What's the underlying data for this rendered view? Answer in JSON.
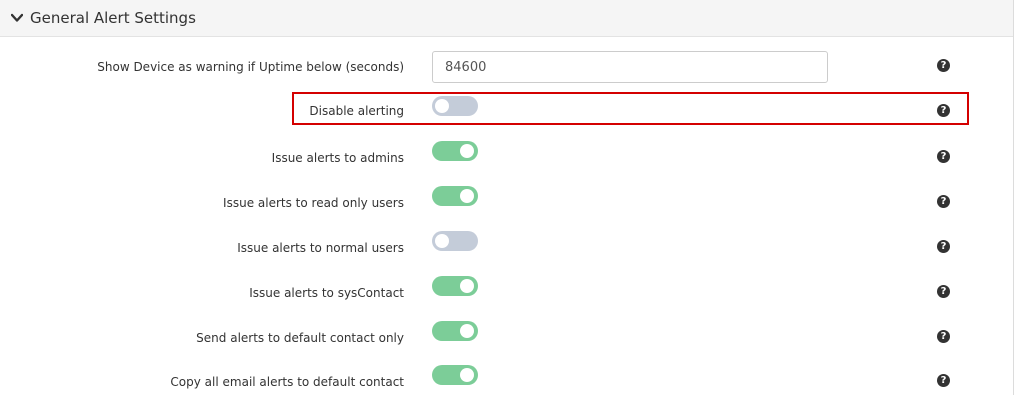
{
  "panel": {
    "title": "General Alert Settings",
    "collapse_icon": "chevron-down-icon"
  },
  "settings": [
    {
      "label": "Show Device as warning if Uptime below (seconds)",
      "type": "text",
      "value": "84600",
      "help_icon": "question-circle-icon"
    },
    {
      "label": "Disable alerting",
      "type": "toggle",
      "state": "off",
      "highlighted": true,
      "help_icon": "question-circle-icon"
    },
    {
      "label": "Issue alerts to admins",
      "type": "toggle",
      "state": "on",
      "help_icon": "question-circle-icon"
    },
    {
      "label": "Issue alerts to read only users",
      "type": "toggle",
      "state": "on",
      "help_icon": "question-circle-icon"
    },
    {
      "label": "Issue alerts to normal users",
      "type": "toggle",
      "state": "off",
      "help_icon": "question-circle-icon"
    },
    {
      "label": "Issue alerts to sysContact",
      "type": "toggle",
      "state": "on",
      "help_icon": "question-circle-icon"
    },
    {
      "label": "Send alerts to default contact only",
      "type": "toggle",
      "state": "on",
      "help_icon": "question-circle-icon"
    },
    {
      "label": "Copy all email alerts to default contact",
      "type": "toggle",
      "state": "on",
      "help_icon": "question-circle-icon"
    }
  ],
  "colors": {
    "toggle_on": "#7ccd98",
    "toggle_off": "#c4ccd9",
    "highlight": "#d40000",
    "header_bg": "#f5f5f5"
  }
}
